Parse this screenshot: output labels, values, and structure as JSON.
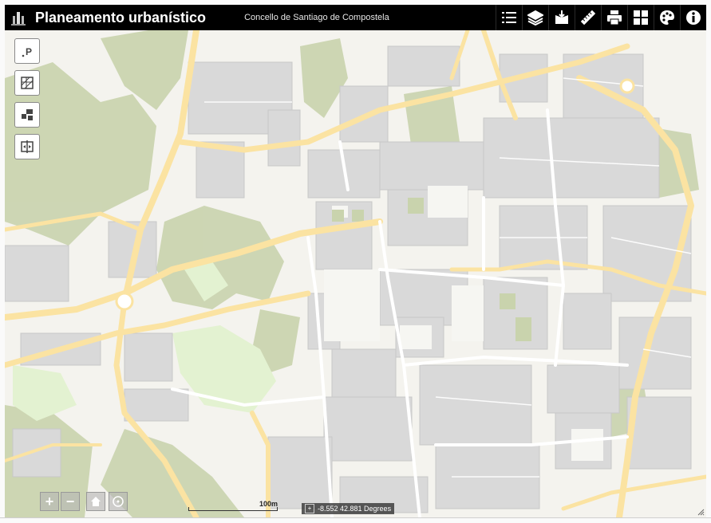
{
  "header": {
    "title": "Planeamento urbanístico",
    "subtitle": "Concello de Santiago de Compostela"
  },
  "toolbar": [
    {
      "name": "legend-icon"
    },
    {
      "name": "layers-icon"
    },
    {
      "name": "basemap-gallery-icon"
    },
    {
      "name": "measure-icon"
    },
    {
      "name": "print-icon"
    },
    {
      "name": "overview-icon"
    },
    {
      "name": "symbology-icon"
    },
    {
      "name": "info-icon"
    }
  ],
  "side_tools": [
    {
      "name": "parcel-search-icon"
    },
    {
      "name": "planning-zones-icon"
    },
    {
      "name": "blocks-icon"
    },
    {
      "name": "compare-icon"
    }
  ],
  "zoom": {
    "in": "+",
    "out": "−"
  },
  "scale": {
    "label": "100m"
  },
  "coordinates": {
    "text": "-8.552 42.881 Degrees"
  },
  "colors": {
    "header_bg": "#000000",
    "road": "#fbe3a2",
    "building": "#d9d9d9",
    "green": "#c9d6ad",
    "park": "#e7f4d8"
  }
}
